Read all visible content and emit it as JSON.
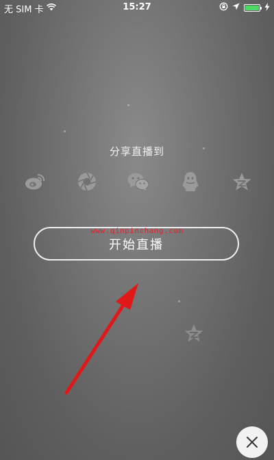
{
  "status_bar": {
    "carrier": "无 SIM 卡",
    "time": "15:27"
  },
  "share": {
    "title": "分享直播到",
    "icons": [
      {
        "name": "weibo-icon"
      },
      {
        "name": "moments-icon"
      },
      {
        "name": "wechat-icon"
      },
      {
        "name": "qq-icon"
      },
      {
        "name": "qzone-icon"
      }
    ]
  },
  "watermark": "www.qinpinchang.com",
  "start_button": {
    "label": "开始直播"
  },
  "colors": {
    "background": "#6e6e6e",
    "icon": "#9a9a9a",
    "watermark": "#e5202a",
    "arrow": "#e01818",
    "battery": "#4cd964"
  }
}
